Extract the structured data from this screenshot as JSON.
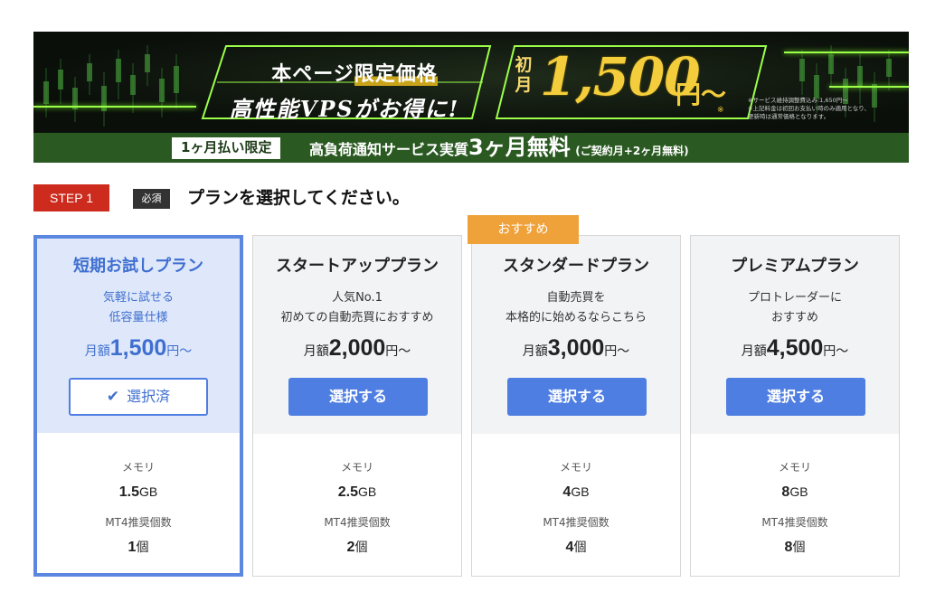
{
  "banner": {
    "headline_line1_pre": "本ページ",
    "headline_line1_highlight": "限定価格",
    "headline_line2": "高性能VPSがお得に!",
    "price_prefix": "初月",
    "price_value": "1,500",
    "price_suffix": "円〜",
    "price_note_mark": "※",
    "fineprint": [
      "※サービス維持調整費込み:1,650円〜",
      "※上記料金は初回お支払い時のみ適用となり、",
      "更新時は通常価格となります。"
    ],
    "period_label": "1ヶ月払い限定",
    "service_text_pre": "高負荷通知サービス実質",
    "service_text_big": "3ヶ月無料",
    "service_text_small": "(ご契約月+2ヶ月無料)"
  },
  "step": {
    "badge": "STEP 1",
    "required": "必須",
    "title": "プランを選択してください。"
  },
  "recommend_label": "おすすめ",
  "plans": [
    {
      "name": "短期お試しプラン",
      "desc_line1": "気軽に試せる",
      "desc_line2": "低容量仕様",
      "price_pre": "月額",
      "price_num": "1,500",
      "price_post": "円〜",
      "button": "選択済",
      "memory_label": "メモリ",
      "memory_value": "1.5",
      "memory_unit": "GB",
      "mt4_label": "MT4推奨個数",
      "mt4_value": "1",
      "mt4_unit": "個"
    },
    {
      "name": "スタートアッププラン",
      "desc_line1": "人気No.1",
      "desc_line2": "初めての自動売買におすすめ",
      "price_pre": "月額",
      "price_num": "2,000",
      "price_post": "円〜",
      "button": "選択する",
      "memory_label": "メモリ",
      "memory_value": "2.5",
      "memory_unit": "GB",
      "mt4_label": "MT4推奨個数",
      "mt4_value": "2",
      "mt4_unit": "個"
    },
    {
      "name": "スタンダードプラン",
      "desc_line1": "自動売買を",
      "desc_line2": "本格的に始めるならこちら",
      "price_pre": "月額",
      "price_num": "3,000",
      "price_post": "円〜",
      "button": "選択する",
      "memory_label": "メモリ",
      "memory_value": "4",
      "memory_unit": "GB",
      "mt4_label": "MT4推奨個数",
      "mt4_value": "4",
      "mt4_unit": "個"
    },
    {
      "name": "プレミアムプラン",
      "desc_line1": "プロトレーダーに",
      "desc_line2": "おすすめ",
      "price_pre": "月額",
      "price_num": "4,500",
      "price_post": "円〜",
      "button": "選択する",
      "memory_label": "メモリ",
      "memory_value": "8",
      "memory_unit": "GB",
      "mt4_label": "MT4推奨個数",
      "mt4_value": "8",
      "mt4_unit": "個"
    }
  ],
  "colors": {
    "accent_blue": "#4f7ee2",
    "step_red": "#cc2b1d",
    "recommend_orange": "#f0a23a",
    "banner_green": "#2a5a22",
    "price_gold": "#f3cd3b"
  }
}
